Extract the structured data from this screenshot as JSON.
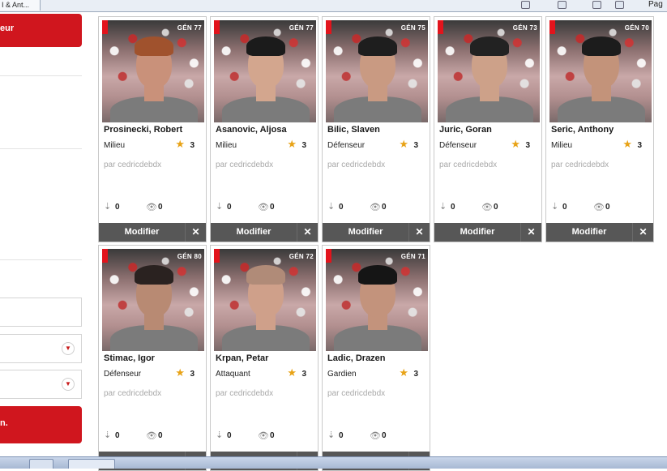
{
  "browser": {
    "tab_title": "I & Ant...",
    "page_label": "Pag"
  },
  "sidebar": {
    "top_button_label": "eur",
    "bottom_button_label": "n."
  },
  "card_actions": {
    "modify_label": "Modifier",
    "delete_label": "✕"
  },
  "colors": {
    "accent_red": "#d0161e",
    "star": "#e8a317",
    "action_bar": "#575757"
  },
  "cards": [
    {
      "rating": "GÉN 77",
      "name": "Prosinecki, Robert",
      "position": "Milieu",
      "stars": "3",
      "author": "par cedricdebdx",
      "downloads": "0",
      "views": "0",
      "skin": "#c9917a",
      "hair": "#a0522d"
    },
    {
      "rating": "GÉN 77",
      "name": "Asanovic, Aljosa",
      "position": "Milieu",
      "stars": "3",
      "author": "par cedricdebdx",
      "downloads": "0",
      "views": "0",
      "skin": "#d3a68e",
      "hair": "#1b1b1b"
    },
    {
      "rating": "GÉN 75",
      "name": "Bilic, Slaven",
      "position": "Défenseur",
      "stars": "3",
      "author": "par cedricdebdx",
      "downloads": "0",
      "views": "0",
      "skin": "#c99a82",
      "hair": "#1e1e1e"
    },
    {
      "rating": "GÉN 73",
      "name": "Juric, Goran",
      "position": "Défenseur",
      "stars": "3",
      "author": "par cedricdebdx",
      "downloads": "0",
      "views": "0",
      "skin": "#cda189",
      "hair": "#222222"
    },
    {
      "rating": "GÉN 70",
      "name": "Seric, Anthony",
      "position": "Milieu",
      "stars": "3",
      "author": "par cedricdebdx",
      "downloads": "0",
      "views": "0",
      "skin": "#c3937a",
      "hair": "#1c1c1c"
    },
    {
      "rating": "GÉN 80",
      "name": "Stimac, Igor",
      "position": "Défenseur",
      "stars": "3",
      "author": "par cedricdebdx",
      "downloads": "0",
      "views": "0",
      "skin": "#b88a73",
      "hair": "#2a2220"
    },
    {
      "rating": "GÉN 72",
      "name": "Krpan, Petar",
      "position": "Attaquant",
      "stars": "3",
      "author": "par cedricdebdx",
      "downloads": "0",
      "views": "0",
      "skin": "#cfa08a",
      "hair": "#b08b78"
    },
    {
      "rating": "GÉN 71",
      "name": "Ladic, Drazen",
      "position": "Gardien",
      "stars": "3",
      "author": "par cedricdebdx",
      "downloads": "0",
      "views": "0",
      "skin": "#c3937c",
      "hair": "#151515"
    }
  ]
}
